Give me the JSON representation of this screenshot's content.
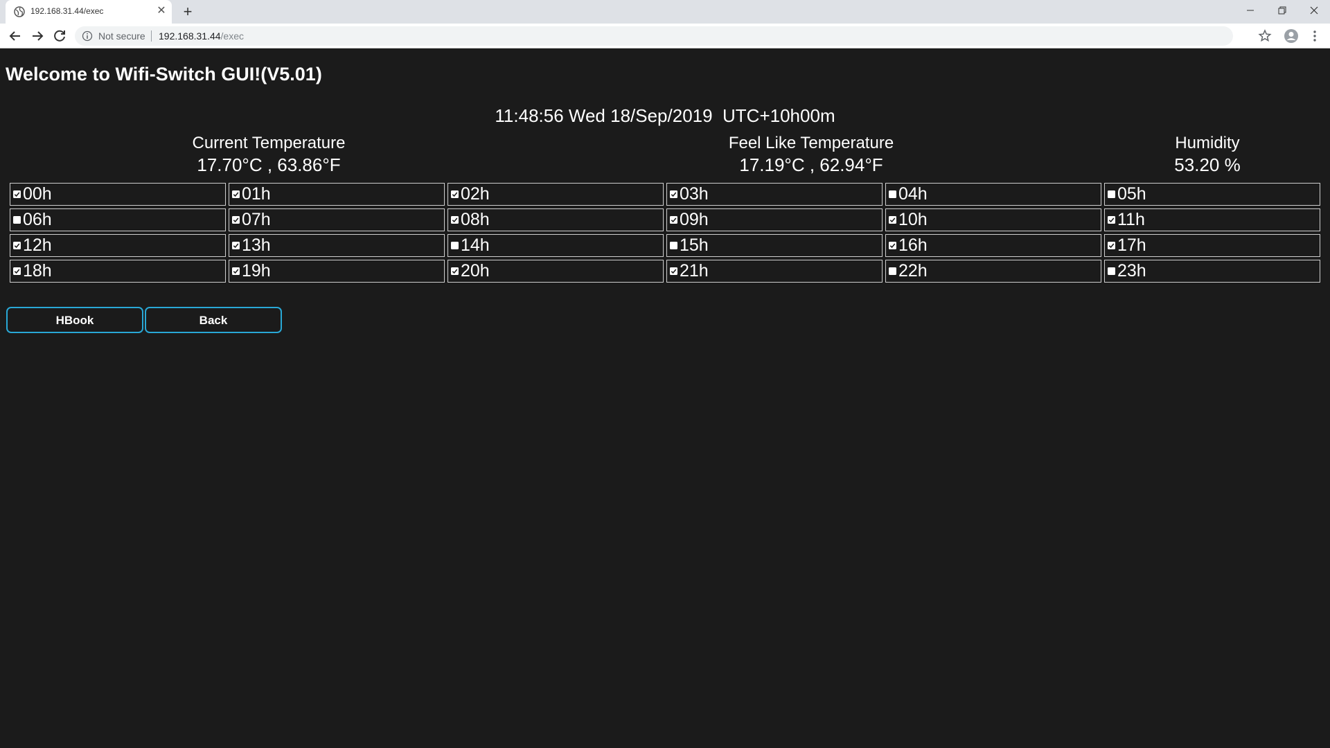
{
  "browser": {
    "tab_title": "192.168.31.44/exec",
    "tab_close": "✕",
    "new_tab": "+",
    "security_label": "Not secure",
    "url_host": "192.168.31.44",
    "url_path": "/exec",
    "window_controls": [
      "–",
      "❐",
      "✕"
    ]
  },
  "page": {
    "title": "Welcome to Wifi-Switch GUI!(V5.01)",
    "clock": "11:48:56 Wed 18/Sep/2019  UTC+10h00m",
    "current_temperature": {
      "label": "Current Temperature",
      "value": "17.70°C , 63.86°F"
    },
    "feel_like_temperature": {
      "label": "Feel Like Temperature",
      "value": "17.19°C , 62.94°F"
    },
    "humidity": {
      "label": "Humidity",
      "value": "53.20 %"
    },
    "hours": [
      {
        "label": "00h",
        "checked": true
      },
      {
        "label": "01h",
        "checked": true
      },
      {
        "label": "02h",
        "checked": true
      },
      {
        "label": "03h",
        "checked": true
      },
      {
        "label": "04h",
        "checked": false
      },
      {
        "label": "05h",
        "checked": false
      },
      {
        "label": "06h",
        "checked": false
      },
      {
        "label": "07h",
        "checked": true
      },
      {
        "label": "08h",
        "checked": true
      },
      {
        "label": "09h",
        "checked": true
      },
      {
        "label": "10h",
        "checked": true
      },
      {
        "label": "11h",
        "checked": true
      },
      {
        "label": "12h",
        "checked": true
      },
      {
        "label": "13h",
        "checked": true
      },
      {
        "label": "14h",
        "checked": false
      },
      {
        "label": "15h",
        "checked": false
      },
      {
        "label": "16h",
        "checked": true
      },
      {
        "label": "17h",
        "checked": true
      },
      {
        "label": "18h",
        "checked": true
      },
      {
        "label": "19h",
        "checked": true
      },
      {
        "label": "20h",
        "checked": true
      },
      {
        "label": "21h",
        "checked": true
      },
      {
        "label": "22h",
        "checked": false
      },
      {
        "label": "23h",
        "checked": false
      }
    ],
    "buttons": {
      "hbook": "HBook",
      "back": "Back"
    },
    "colors": {
      "background": "#1b1b1b",
      "text": "#ffffff",
      "button_border": "#29a8d6",
      "cell_border": "#cfcfcf"
    }
  }
}
